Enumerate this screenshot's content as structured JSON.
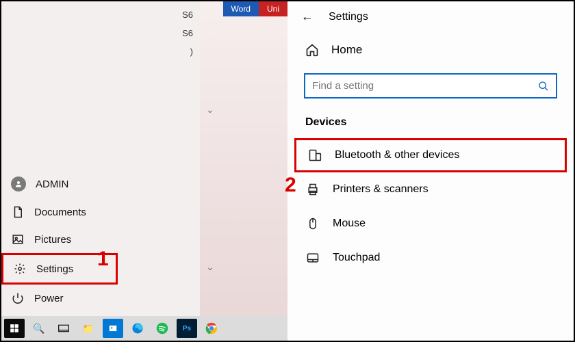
{
  "annotations": {
    "step1": "1",
    "step2": "2"
  },
  "tiles": {
    "word": "Word",
    "uni": "Uni"
  },
  "apps_fragments": [
    "S6",
    "S6",
    ")"
  ],
  "start_menu": {
    "user": "ADMIN",
    "documents": "Documents",
    "pictures": "Pictures",
    "settings": "Settings",
    "power": "Power"
  },
  "settings": {
    "title": "Settings",
    "home": "Home",
    "search_placeholder": "Find a setting",
    "section": "Devices",
    "items": {
      "bluetooth": "Bluetooth & other devices",
      "printers": "Printers & scanners",
      "mouse": "Mouse",
      "touchpad": "Touchpad"
    }
  }
}
